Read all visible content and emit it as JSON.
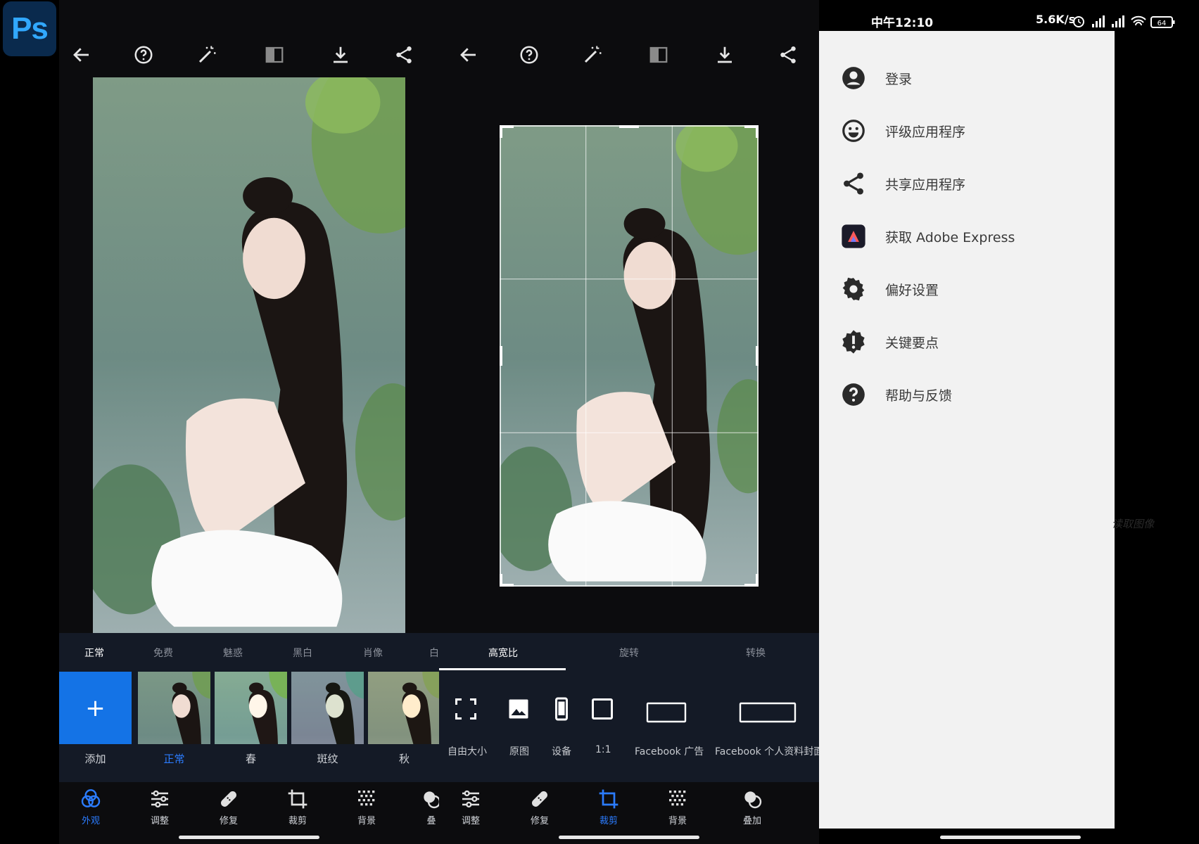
{
  "app": {
    "logo_text": "Ps"
  },
  "status_bar": {
    "time": "中午12:10",
    "speed": "5.6K/s",
    "battery": "64"
  },
  "panel_left": {
    "filter_tabs": [
      "正常",
      "免费",
      "魅惑",
      "黑白",
      "肖像",
      "白"
    ],
    "filters": [
      "添加",
      "正常",
      "春",
      "斑纹",
      "秋"
    ],
    "nav": [
      {
        "label": "外观",
        "icon": "looks-icon"
      },
      {
        "label": "调整",
        "icon": "sliders-icon"
      },
      {
        "label": "修复",
        "icon": "bandage-icon"
      },
      {
        "label": "裁剪",
        "icon": "crop-icon"
      },
      {
        "label": "背景",
        "icon": "background-icon"
      },
      {
        "label": "叠",
        "icon": "overlay-icon"
      }
    ]
  },
  "panel_middle": {
    "crop_tabs": [
      "高宽比",
      "旋转",
      "转换"
    ],
    "ratios": [
      "自由大小",
      "原图",
      "设备",
      "1:1",
      "Facebook 广告",
      "Facebook 个人资料封面"
    ],
    "nav": [
      {
        "label": "调整",
        "icon": "sliders-icon"
      },
      {
        "label": "修复",
        "icon": "bandage-icon"
      },
      {
        "label": "裁剪",
        "icon": "crop-icon"
      },
      {
        "label": "背景",
        "icon": "background-icon"
      },
      {
        "label": "叠加",
        "icon": "overlay-icon"
      }
    ]
  },
  "drawer_menu": {
    "items": [
      {
        "label": "登录",
        "icon": "account-icon"
      },
      {
        "label": "评级应用程序",
        "icon": "smiley-icon"
      },
      {
        "label": "共享应用程序",
        "icon": "share-icon"
      },
      {
        "label": "获取 Adobe Express",
        "icon": "adobe-express-icon"
      },
      {
        "label": "偏好设置",
        "icon": "gear-icon"
      },
      {
        "label": "关键要点",
        "icon": "alert-badge-icon"
      },
      {
        "label": "帮助与反馈",
        "icon": "help-icon"
      }
    ]
  },
  "background_hint": "读取图像",
  "colors": {
    "accent": "#1473e6",
    "nav_active": "#2b7cff",
    "panel_bg": "#141a26",
    "drawer_bg": "#f2f2f2"
  }
}
